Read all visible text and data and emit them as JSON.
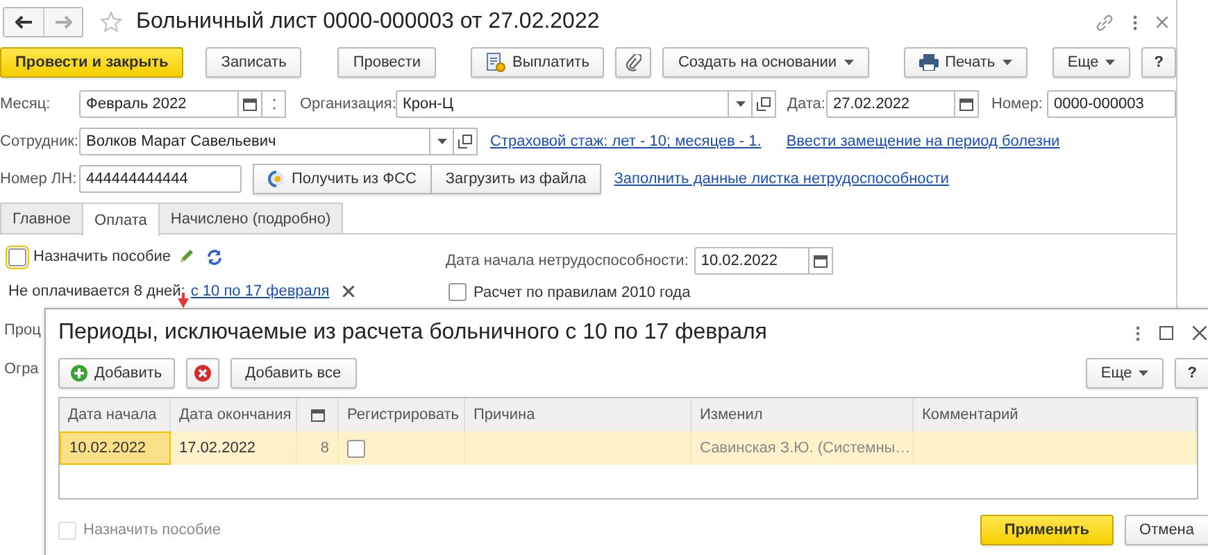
{
  "window": {
    "title": "Больничный лист 0000-000003 от 27.02.2022",
    "favorite": false
  },
  "toolbar": [
    {
      "label": "Провести и закрыть",
      "kind": "primary"
    },
    {
      "label": "Записать",
      "kind": "plain"
    },
    {
      "label": "Провести",
      "kind": "plain"
    },
    {
      "label": "Выплатить",
      "kind": "pay"
    },
    {
      "kind": "attach"
    },
    {
      "label": "Создать на основании",
      "kind": "menu"
    },
    {
      "label": "Печать",
      "kind": "print"
    },
    {
      "label": "Еще",
      "kind": "more"
    },
    {
      "label": "?",
      "kind": "help"
    }
  ],
  "month": {
    "label": "Месяц:",
    "value": "Февраль 2022"
  },
  "organization": {
    "label": "Организация:",
    "value": "Крон-Ц"
  },
  "date": {
    "label": "Дата:",
    "value": "27.02.2022"
  },
  "number": {
    "label": "Номер:",
    "value": "0000-000003"
  },
  "employee": {
    "label": "Сотрудник:",
    "value": "Волков Марат Савельевич"
  },
  "insurance_link": "Страховой стаж: лет - 10; месяцев - 1.",
  "substitute_link": "Ввести замещение на период болезни",
  "ln_number": {
    "label": "Номер ЛН:",
    "value": "444444444444"
  },
  "fss_button": "Получить из ФСС",
  "file_button": "Загрузить из файла",
  "fill_link": "Заполнить данные листка нетрудоспособности",
  "tabs": [
    {
      "label": "Главное",
      "selected": false
    },
    {
      "label": "Оплата",
      "selected": true
    },
    {
      "label": "Начислено (подробно)",
      "selected": false
    }
  ],
  "payment": {
    "assign_benefit": {
      "label": "Назначить пособие",
      "checked": false
    },
    "unpaid_text": "Не оплачивается 8 дней:",
    "unpaid_link": "с 10 по 17 февраля",
    "start_date": {
      "label": "Дата начала нетрудоспособности:",
      "value": "10.02.2022"
    },
    "rules_2010": {
      "label": "Расчет по правилам 2010 года",
      "checked": false
    },
    "covered_labels": [
      "Проц",
      "Огра"
    ]
  },
  "dialog": {
    "title": "Периоды, исключаемые из расчета больничного с 10 по 17 февраля",
    "toolbar": [
      {
        "label": "Добавить",
        "kind": "add"
      },
      {
        "kind": "delete"
      },
      {
        "label": "Добавить все",
        "kind": "plain"
      }
    ],
    "more_button": "Еще",
    "help_button": "?",
    "columns": [
      {
        "label": "Дата начала",
        "kind": "text"
      },
      {
        "label": "Дата окончания",
        "kind": "text"
      },
      {
        "kind": "icon"
      },
      {
        "label": "Регистрировать",
        "kind": "text"
      },
      {
        "label": "Причина",
        "kind": "text"
      },
      {
        "label": "Изменил",
        "kind": "text"
      },
      {
        "label": "Комментарий",
        "kind": "text"
      }
    ],
    "rows": [
      {
        "selected": true,
        "start": "10.02.2022",
        "end": "17.02.2022",
        "days": "8",
        "register": false,
        "changed_by": "Савинская З.Ю. (Системны…"
      }
    ],
    "assign_benefit": {
      "label": "Назначить пособие",
      "checked": false,
      "disabled": true
    },
    "apply_button": "Применить",
    "cancel_button": "Отмена"
  }
}
